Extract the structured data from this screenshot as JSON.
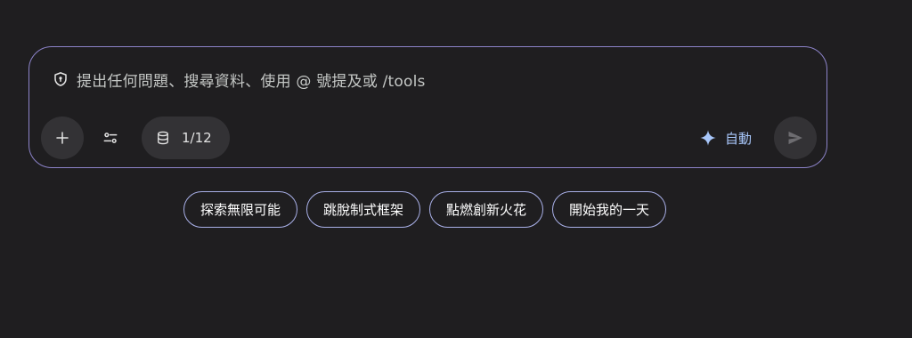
{
  "prompt": {
    "placeholder": "提出任何問題、搜尋資料、使用 @ 號提及或 /tools",
    "shield_icon": "shield-icon",
    "add_icon": "plus-icon",
    "tools_icon": "tune-sliders-icon",
    "database_icon": "database-icon",
    "database_count": "1/12",
    "mode_icon": "sparkle-icon",
    "mode_label": "自動",
    "send_icon": "send-icon"
  },
  "suggestions": [
    {
      "label": "探索無限可能"
    },
    {
      "label": "跳脫制式框架"
    },
    {
      "label": "點燃創新火花"
    },
    {
      "label": "開始我的一天"
    }
  ],
  "colors": {
    "background": "#1f1e20",
    "box_border": "#8c83c9",
    "chip_border": "#a9b0e8",
    "accent": "#a8c7fa",
    "button_bg": "#333235"
  }
}
